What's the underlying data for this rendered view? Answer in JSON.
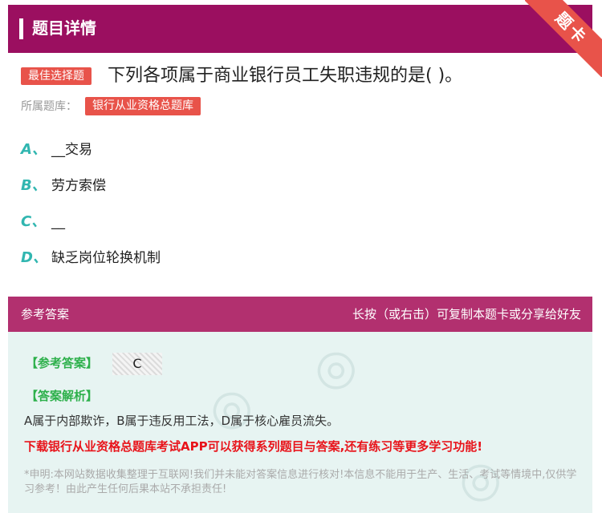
{
  "header": {
    "title": "题目详情",
    "corner_label": "题卡"
  },
  "question": {
    "type_badge": "最佳选择题",
    "text": "下列各项属于商业银行员工失职违规的是( )。",
    "bank_label": "所属题库：",
    "bank_name": "银行从业资格总题库"
  },
  "options": [
    {
      "letter": "A、",
      "text": "__交易"
    },
    {
      "letter": "B、",
      "text": "劳方索偿"
    },
    {
      "letter": "C、",
      "text": "__"
    },
    {
      "letter": "D、",
      "text": "缺乏岗位轮换机制"
    }
  ],
  "answer": {
    "header_left": "参考答案",
    "header_right": "长按（或右击）可复制本题卡或分享给好友",
    "ref_label": "【参考答案】",
    "ref_value": "C",
    "analysis_label": "【答案解析】",
    "analysis_text": "A属于内部欺诈，B属于违反用工法，D属于核心雇员流失。",
    "promo": "下载银行从业资格总题库考试APP可以获得系列题目与答案,还有练习等更多学习功能!",
    "disclaimer": "*申明:本网站数据收集整理于互联网!我们并未能对答案信息进行核对!本信息不能用于生产、生活、考试等情境中,仅供学习参考！由此产生任何后果本站不承担责任!"
  },
  "colors": {
    "header_bg": "#9b0f60",
    "answer_header_bg": "#b2306f",
    "badge_red": "#e8534a",
    "option_letter": "#31b6b0",
    "label_green": "#2db04b",
    "promo_red": "#e8141b",
    "answer_body_bg": "#e7f4f2"
  }
}
